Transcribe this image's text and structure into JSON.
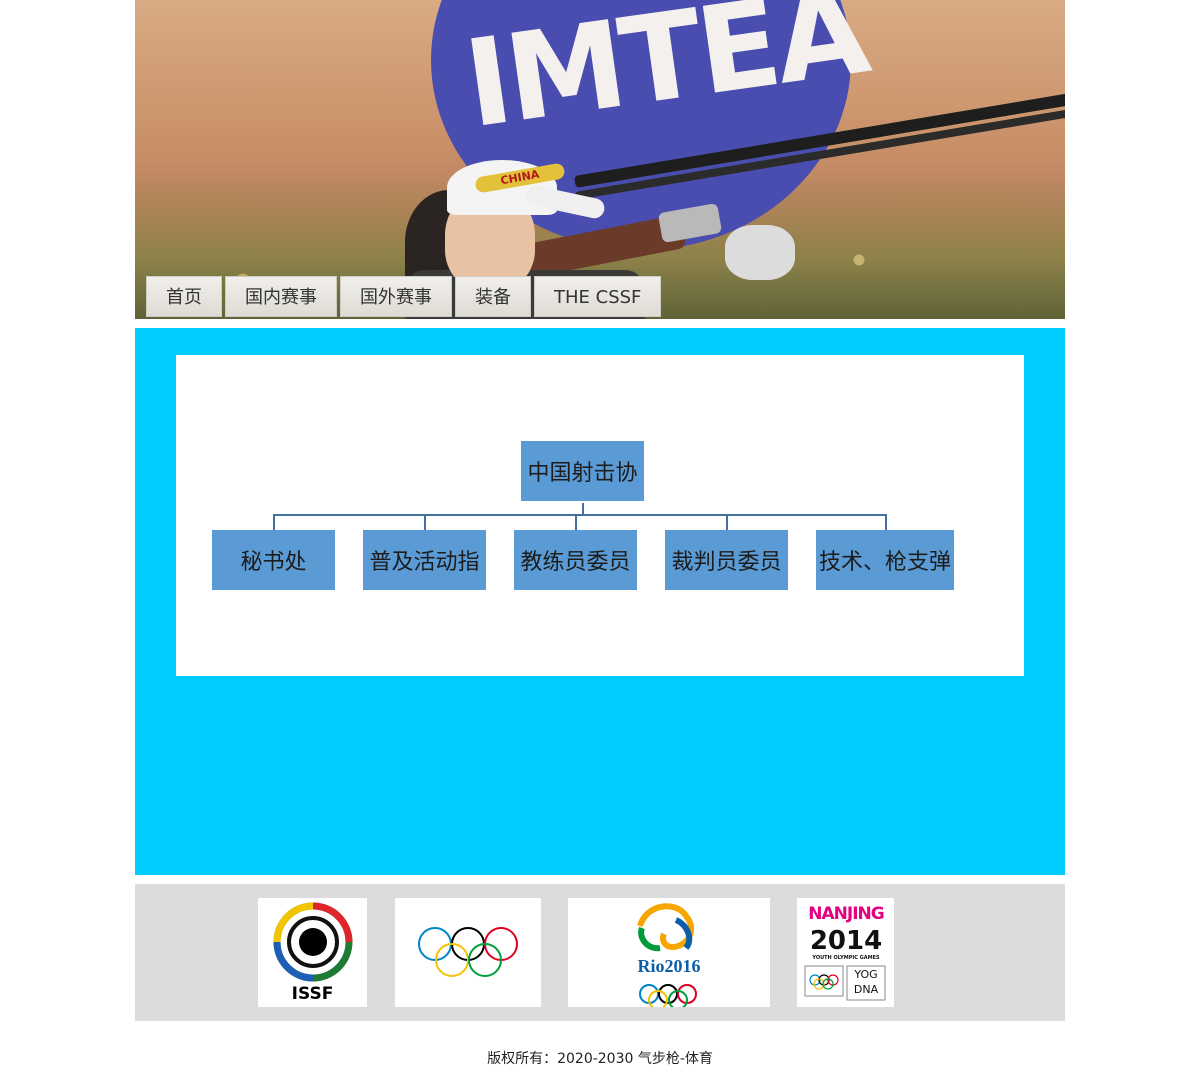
{
  "nav": {
    "items": [
      "首页",
      "国内赛事",
      "国外赛事",
      "装备",
      "THE CSSF"
    ]
  },
  "banner": {
    "background_text": "IMTEA",
    "cap_text": "CHINA"
  },
  "org_chart": {
    "root": "中国射击协",
    "children": [
      "秘书处",
      "普及活动指",
      "教练员委员",
      "裁判员委员",
      "技术、枪支弹"
    ]
  },
  "logos": {
    "issf": "ISSF",
    "rio": "Rio2016",
    "nanjing_top": "NANJING",
    "nanjing_year": "2014",
    "nanjing_sub": "YOUTH OLYMPIC GAMES",
    "nanjing_yog": "YOG",
    "nanjing_dna": "DNA"
  },
  "footer": {
    "copyright": "版权所有：2020-2030 气步枪-体育"
  },
  "colors": {
    "main_bg": "#00ccff",
    "org_box": "#5b9bd5",
    "logo_strip": "#dcdcdc"
  }
}
